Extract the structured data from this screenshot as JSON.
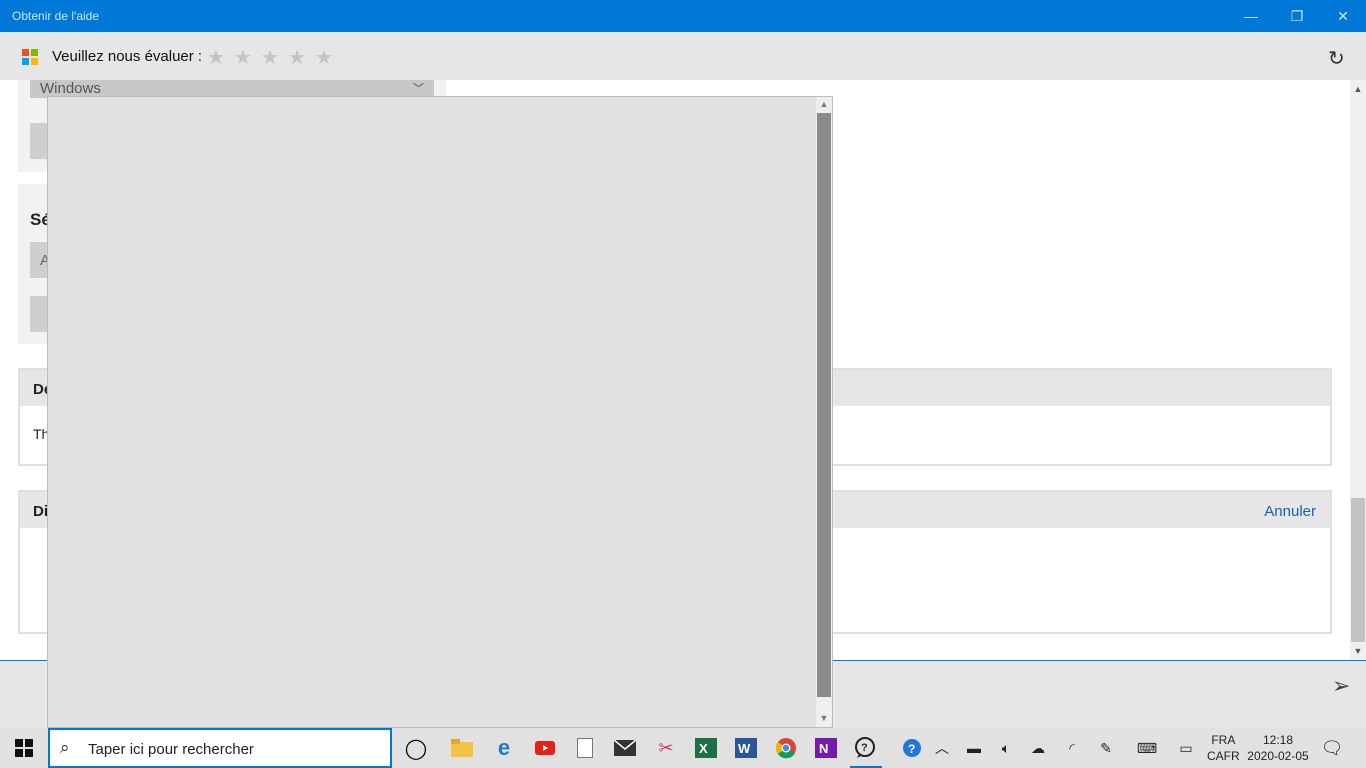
{
  "window": {
    "title": "Obtenir de l'aide",
    "minimize": "—",
    "maximize": "❐",
    "close": "✕"
  },
  "rating": {
    "label": "Veuillez nous évaluer :",
    "stars": [
      "★",
      "★",
      "★",
      "★",
      "★"
    ],
    "refresh": "↻"
  },
  "content": {
    "product_select": "Windows",
    "section2_title": "Sé",
    "section2_select": "A",
    "details": {
      "head": "De",
      "body": "Th"
    },
    "discussion": {
      "head": "Di",
      "cancel": "Annuler"
    }
  },
  "input": {
    "send": "➢"
  },
  "taskbar": {
    "search_placeholder": "Taper ici pour rechercher",
    "language": {
      "line1": "FRA",
      "line2": "CAFR"
    },
    "clock": {
      "time": "12:18",
      "date": "2020-02-05"
    }
  },
  "colors": {
    "accent": "#0078d7",
    "taskbar": "#e1e1e1"
  }
}
